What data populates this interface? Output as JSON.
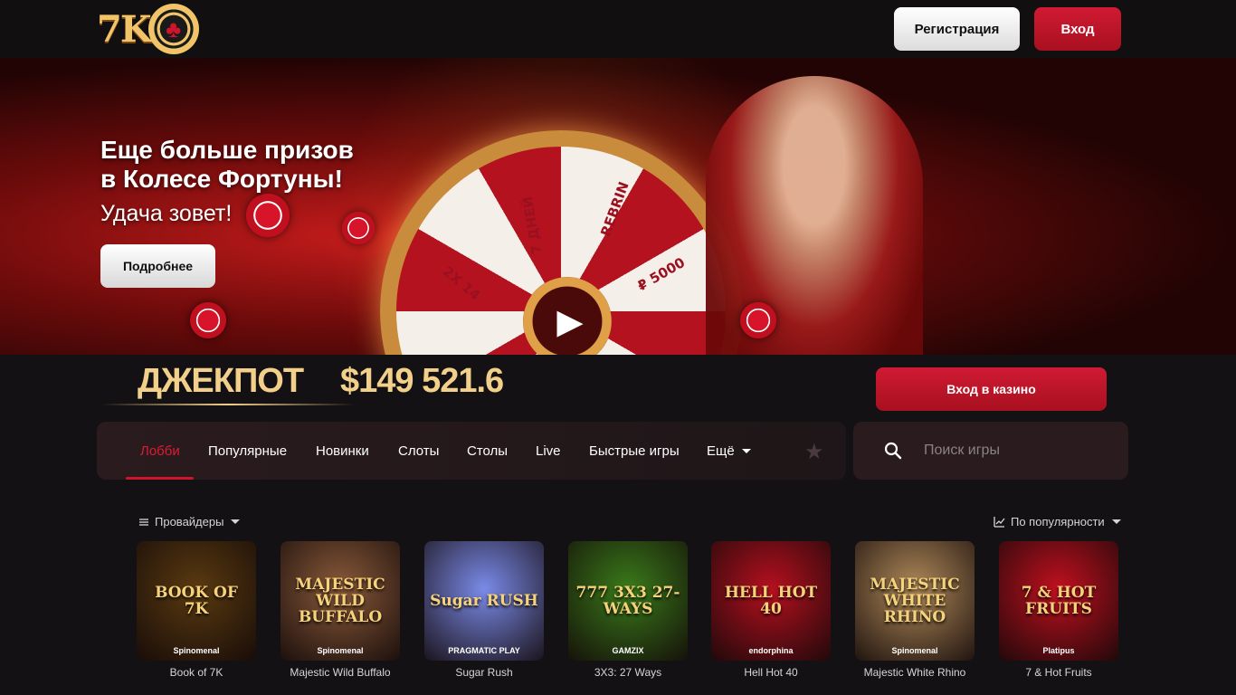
{
  "header": {
    "logo_text": "7K",
    "register_label": "Регистрация",
    "login_label": "Вход"
  },
  "banner": {
    "title": "Еще больше призов в Колесе Фортуны!",
    "subtitle": "Удача зовет!",
    "more_label": "Подробнее",
    "wheel_labels": [
      "REBRIN",
      "7 ДНЕЙ",
      "2X 14",
      "₽ 5000"
    ]
  },
  "jackpot": {
    "label": "ДЖЕКПОТ",
    "value": "$149 521.6",
    "casino_button": "Вход в казино"
  },
  "nav": {
    "items": [
      "Лобби",
      "Популярные",
      "Новинки",
      "Слоты",
      "Столы",
      "Live",
      "Быстрые игры",
      "Ещё"
    ],
    "active": "Лобби"
  },
  "search": {
    "placeholder": "Поиск игры"
  },
  "filters": {
    "providers_label": "Провайдеры",
    "sort_label": "По популярности"
  },
  "games": [
    {
      "name": "Book of 7K",
      "thumb_text": "BOOK OF 7K",
      "provider": "Spinomenal",
      "color": "#5a3a10"
    },
    {
      "name": "Majestic Wild Buffalo",
      "thumb_text": "MAJESTIC WILD BUFFALO",
      "provider": "Spinomenal",
      "color": "#8a5a3a"
    },
    {
      "name": "Sugar Rush",
      "thumb_text": "Sugar RUSH",
      "provider": "PRAGMATIC PLAY",
      "color": "#7a8ae8"
    },
    {
      "name": "3X3: 27 Ways",
      "thumb_text": "777 3X3 27-WAYS",
      "provider": "GAMZIX",
      "color": "#3a7a1a"
    },
    {
      "name": "Hell Hot 40",
      "thumb_text": "HELL HOT 40",
      "provider": "endorphina",
      "color": "#b5101f"
    },
    {
      "name": "Majestic White Rhino",
      "thumb_text": "MAJESTIC WHITE RHINO",
      "provider": "Spinomenal",
      "color": "#b08a5a"
    },
    {
      "name": "7 & Hot Fruits",
      "thumb_text": "7 & HOT FRUITS",
      "provider": "Platipus",
      "color": "#c0101f"
    }
  ]
}
